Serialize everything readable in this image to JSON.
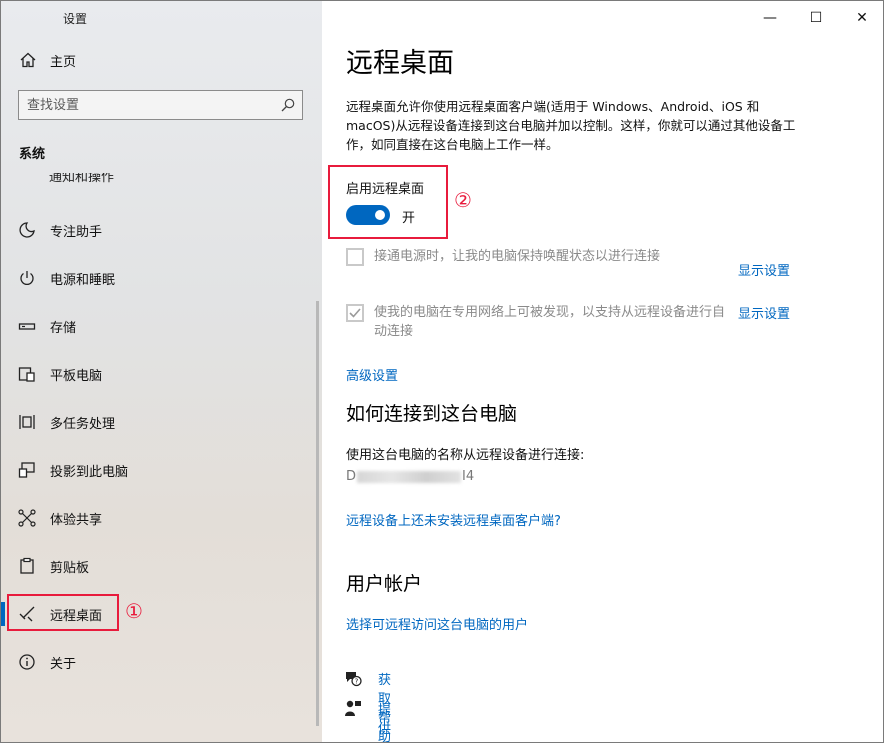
{
  "window": {
    "title": "设置",
    "minimize_glyph": "—",
    "maximize_glyph": "☐",
    "close_glyph": "✕"
  },
  "sidebar": {
    "back_glyph": "←",
    "home_label": "主页",
    "search_placeholder": "查找设置",
    "section_label": "系统",
    "cut_item_label": "通知和操作",
    "items": [
      {
        "label": "专注助手",
        "icon": "moon-icon"
      },
      {
        "label": "电源和睡眠",
        "icon": "power-icon"
      },
      {
        "label": "存储",
        "icon": "storage-icon"
      },
      {
        "label": "平板电脑",
        "icon": "tablet-icon"
      },
      {
        "label": "多任务处理",
        "icon": "multitask-icon"
      },
      {
        "label": "投影到此电脑",
        "icon": "project-icon"
      },
      {
        "label": "体验共享",
        "icon": "share-icon"
      },
      {
        "label": "剪贴板",
        "icon": "clipboard-icon"
      },
      {
        "label": "远程桌面",
        "icon": "remote-desktop-icon",
        "active": true
      },
      {
        "label": "关于",
        "icon": "info-icon"
      }
    ]
  },
  "annotations": {
    "marker_1": "①",
    "marker_2": "②",
    "highlight_color": "#e81b3c"
  },
  "main": {
    "title": "远程桌面",
    "description": "远程桌面允许你使用远程桌面客户端(适用于 Windows、Android、iOS 和 macOS)从远程设备连接到这台电脑并加以控制。这样，你就可以通过其他设备工作，如同直接在这台电脑上工作一样。",
    "toggle": {
      "label": "启用远程桌面",
      "state": "开",
      "on": true,
      "color": "#0067c0"
    },
    "checkbox1": {
      "label": "接通电源时，让我的电脑保持唤醒状态以进行连接",
      "checked": false,
      "link": "显示设置"
    },
    "checkbox2": {
      "label": "使我的电脑在专用网络上可被发现，以支持从远程设备进行自动连接",
      "checked": true,
      "link": "显示设置"
    },
    "advanced_link": "高级设置",
    "how_to_title": "如何连接到这台电脑",
    "how_to_text": "使用这台电脑的名称从远程设备进行连接:",
    "pc_name_prefix": "D",
    "pc_name_suffix": "I4",
    "client_link": "远程设备上还未安装远程桌面客户端?",
    "accounts_title": "用户帐户",
    "accounts_link": "选择可远程访问这台电脑的用户",
    "help_link": "获取帮助",
    "feedback_link": "提供反馈"
  }
}
